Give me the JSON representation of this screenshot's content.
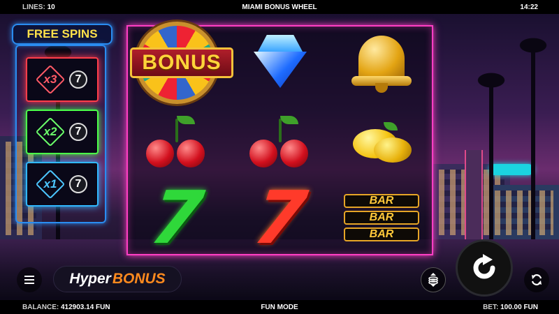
{
  "topbar": {
    "lines_label": "LINES:",
    "lines_value": "10",
    "title": "MIAMI BONUS WHEEL",
    "clock": "14:22"
  },
  "free_spins": {
    "title": "FREE SPINS",
    "multipliers": [
      {
        "label": "x3",
        "spins": "7",
        "color": "#ff3d4a"
      },
      {
        "label": "x2",
        "spins": "7",
        "color": "#4cff4a"
      },
      {
        "label": "x1",
        "spins": "7",
        "color": "#31b8ff"
      }
    ]
  },
  "reels": {
    "columns": [
      [
        "bonus-wheel",
        "cherries",
        "green-seven"
      ],
      [
        "diamond",
        "cherries",
        "red-seven"
      ],
      [
        "bell",
        "lemon",
        "bar-bar-bar"
      ]
    ],
    "bonus_label": "BONUS",
    "bar_label": "BAR",
    "seven_label": "7"
  },
  "controls": {
    "hyper_part1": "Hyper",
    "hyper_part2": "BONUS",
    "menu_icon": "menu-icon",
    "coins_icon": "coins-icon",
    "spin_icon": "spin-icon",
    "autoplay_icon": "autoplay-icon"
  },
  "bottombar": {
    "balance_label": "BALANCE:",
    "balance_value": "412903.14 FUN",
    "mode": "FUN MODE",
    "bet_label": "BET:",
    "bet_value": "100.00 FUN"
  },
  "colors": {
    "reel_frame": "#ff3ec4",
    "panel_frame": "#2a8cf0",
    "title_gold": "#ffe14a",
    "hyper_orange": "#ff8a1e"
  }
}
